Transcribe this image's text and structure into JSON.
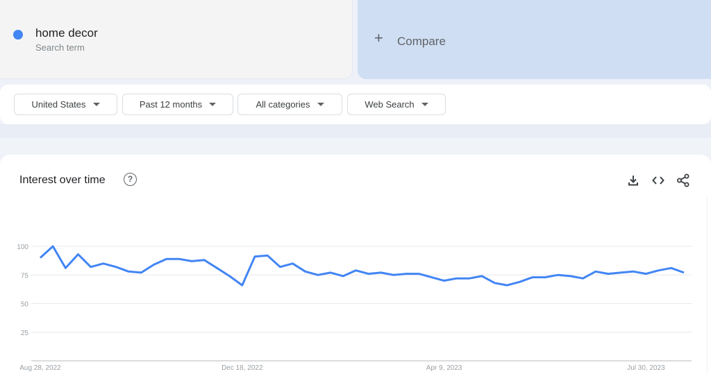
{
  "search_term": {
    "title": "home decor",
    "subtitle": "Search term",
    "color": "#4285f4"
  },
  "compare": {
    "icon": "plus-icon",
    "plus": "+",
    "label": "Compare"
  },
  "filters": [
    {
      "label": "United States"
    },
    {
      "label": "Past 12 months"
    },
    {
      "label": "All categories"
    },
    {
      "label": "Web Search"
    }
  ],
  "panel": {
    "title": "Interest over time",
    "help_icon": "?",
    "actions": [
      "download-icon",
      "embed-code-icon",
      "share-icon"
    ]
  },
  "chart_data": {
    "type": "line",
    "title": "Interest over time",
    "xlabel": "",
    "ylabel": "",
    "ylim": [
      0,
      100
    ],
    "yticks": [
      25,
      50,
      75,
      100
    ],
    "xtick_labels": [
      {
        "label": "Aug 28, 2022",
        "index": 0
      },
      {
        "label": "Dec 18, 2022",
        "index": 16
      },
      {
        "label": "Apr 9, 2023",
        "index": 32
      },
      {
        "label": "Jul 30, 2023",
        "index": 48
      }
    ],
    "grid": true,
    "legend": "none",
    "series": [
      {
        "name": "home decor",
        "color": "#4285f4",
        "values": [
          90,
          100,
          81,
          93,
          82,
          85,
          82,
          78,
          77,
          84,
          89,
          89,
          87,
          88,
          81,
          74,
          66,
          91,
          92,
          82,
          85,
          78,
          75,
          77,
          74,
          79,
          76,
          77,
          75,
          76,
          76,
          73,
          70,
          72,
          72,
          74,
          68,
          66,
          69,
          73,
          73,
          75,
          74,
          72,
          78,
          76,
          77,
          78,
          76,
          79,
          81,
          77
        ]
      }
    ]
  }
}
